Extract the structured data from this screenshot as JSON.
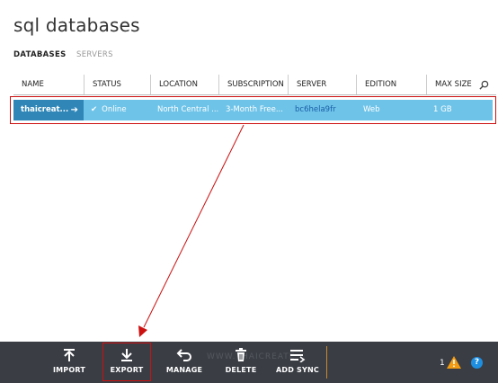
{
  "page": {
    "title": "sql databases"
  },
  "tabs": [
    {
      "label": "DATABASES"
    },
    {
      "label": "SERVERS"
    }
  ],
  "columns": [
    "NAME",
    "STATUS",
    "LOCATION",
    "SUBSCRIPTION",
    "SERVER",
    "EDITION",
    "MAX SIZE"
  ],
  "row": {
    "name": "thaicreat...",
    "status": "Online",
    "location": "North Central ...",
    "subscription": "3-Month Free...",
    "server": "bc6hela9fr",
    "edition": "Web",
    "max_size": "1 GB"
  },
  "commands": [
    {
      "label": "IMPORT",
      "icon": "import-icon"
    },
    {
      "label": "EXPORT",
      "icon": "export-icon"
    },
    {
      "label": "MANAGE",
      "icon": "manage-icon"
    },
    {
      "label": "DELETE",
      "icon": "delete-icon"
    },
    {
      "label": "ADD SYNC",
      "icon": "add-sync-icon"
    }
  ],
  "watermark": "WWW.THAICREATE",
  "notifications": {
    "count": "1"
  },
  "help": {
    "label": "?"
  },
  "colors": {
    "selected_row": "#6ec3e8",
    "name_cell": "#2f86b7",
    "command_bar": "#3a3d44",
    "annotation": "#cc1111"
  }
}
